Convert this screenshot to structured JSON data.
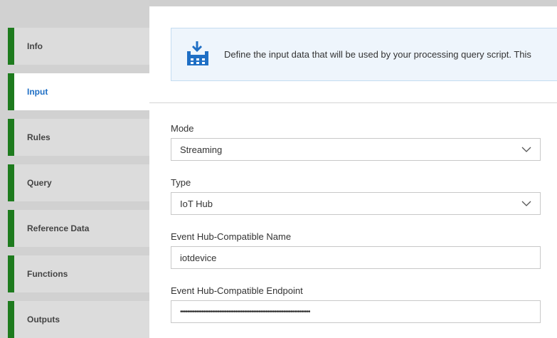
{
  "sidebar": {
    "items": [
      {
        "label": "Info"
      },
      {
        "label": "Input",
        "active": true
      },
      {
        "label": "Rules"
      },
      {
        "label": "Query"
      },
      {
        "label": "Reference Data"
      },
      {
        "label": "Functions"
      },
      {
        "label": "Outputs"
      }
    ]
  },
  "banner": {
    "icon": "input-data-icon",
    "text": "Define the input data that will be used by your processing query script. This"
  },
  "form": {
    "mode": {
      "label": "Mode",
      "value": "Streaming"
    },
    "type": {
      "label": "Type",
      "value": "IoT Hub"
    },
    "name": {
      "label": "Event Hub-Compatible Name",
      "value": "iotdevice"
    },
    "endpoint": {
      "label": "Event Hub-Compatible Endpoint",
      "value": "•••••••••••••••••••••••••••••••••••••••••••••••••••••••••••••••••••••••••"
    }
  },
  "colors": {
    "accent_green": "#1e7b1e",
    "active_text": "#1f6fc5",
    "banner_bg": "#eef5fc",
    "icon_blue": "#1f6fc5"
  }
}
